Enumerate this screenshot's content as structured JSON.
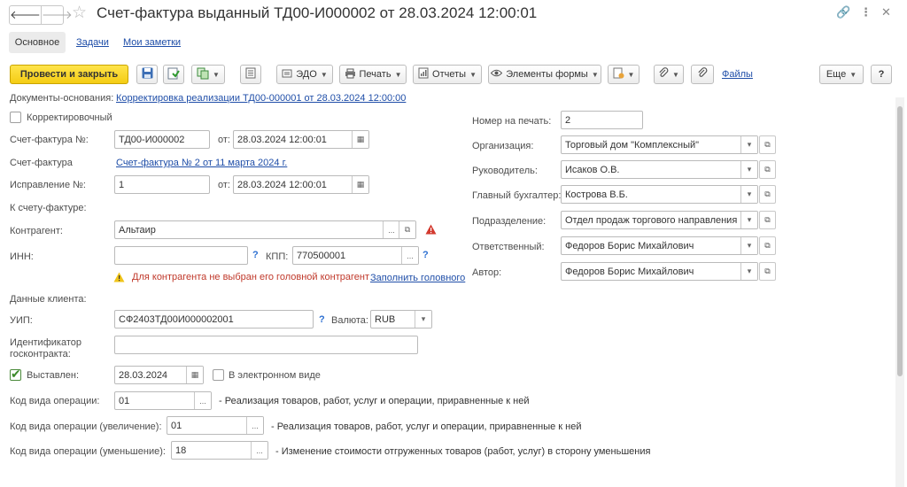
{
  "window": {
    "title": "Счет-фактура выданный ТД00-И000002 от 28.03.2024 12:00:01",
    "back_icon": "arrow-left",
    "forward_icon": "arrow-right",
    "star_icon": "star",
    "link_icon": "link",
    "more_icon": "ellipsis-vertical",
    "close_icon": "close"
  },
  "tabs": {
    "main": "Основное",
    "tasks": "Задачи",
    "notes": "Мои заметки"
  },
  "toolbar": {
    "post_close": "Провести и закрыть",
    "edo": "ЭДО",
    "print": "Печать",
    "reports": "Отчеты",
    "form_elements": "Элементы формы",
    "files": "Файлы",
    "more": "Еще",
    "help": "?"
  },
  "form": {
    "base_docs_label": "Документы-основания:",
    "base_docs_link": "Корректировка реализации ТД00-000001 от 28.03.2024 12:00:00",
    "corrective_label": "Корректировочный",
    "invoice_no_label": "Счет-фактура №:",
    "invoice_no": "ТД00-И000002",
    "from_label": "от:",
    "invoice_date": "28.03.2024 12:00:01",
    "invoice_label": "Счет-фактура",
    "invoice_link": "Счет-фактура № 2 от 11 марта 2024 г.",
    "fix_no_label": "Исправление №:",
    "fix_no": "1",
    "fix_date": "28.03.2024 12:00:01",
    "to_invoice_label": "К счету-фактуре:",
    "counterparty_label": "Контрагент:",
    "counterparty": "Альтаир",
    "inn_label": "ИНН:",
    "inn": "",
    "kpp_label": "КПП:",
    "kpp": "770500001",
    "head_warning": "Для контрагента не выбран его головной контрагент",
    "fill_head": "Заполнить головного",
    "client_data_label": "Данные клиента:",
    "uip_label": "УИП:",
    "uip": "СФ2403ТД00И000002001",
    "currency_label": "Валюта:",
    "currency": "RUB",
    "gov_contract_label_1": "Идентификатор",
    "gov_contract_label_2": "госконтракта:",
    "gov_contract": "",
    "issued_label": "Выставлен:",
    "issued_date": "28.03.2024",
    "electronic_label": "В электронном виде",
    "op_code_label": "Код вида операции:",
    "op_code": "01",
    "op_code_desc": "- Реализация товаров, работ, услуг и операции, приравненные к ней",
    "op_code_inc_label": "Код вида операции (увеличение):",
    "op_code_inc": "01",
    "op_code_inc_desc": "- Реализация товаров, работ, услуг и операции, приравненные к ней",
    "op_code_dec_label": "Код вида операции (уменьшение):",
    "op_code_dec": "18",
    "op_code_dec_desc": "- Изменение стоимости отгруженных товаров (работ, услуг) в сторону уменьшения"
  },
  "right": {
    "print_no_label": "Номер на печать:",
    "print_no": "2",
    "org_label": "Организация:",
    "org": "Торговый дом \"Комплексный\"",
    "head_label": "Руководитель:",
    "head": "Исаков О.В.",
    "accountant_label": "Главный бухгалтер:",
    "accountant": "Кострова В.Б.",
    "dept_label": "Подразделение:",
    "dept": "Отдел продаж торгового направления",
    "resp_label": "Ответственный:",
    "resp": "Федоров Борис Михайлович",
    "author_label": "Автор:",
    "author": "Федоров Борис Михайлович"
  }
}
